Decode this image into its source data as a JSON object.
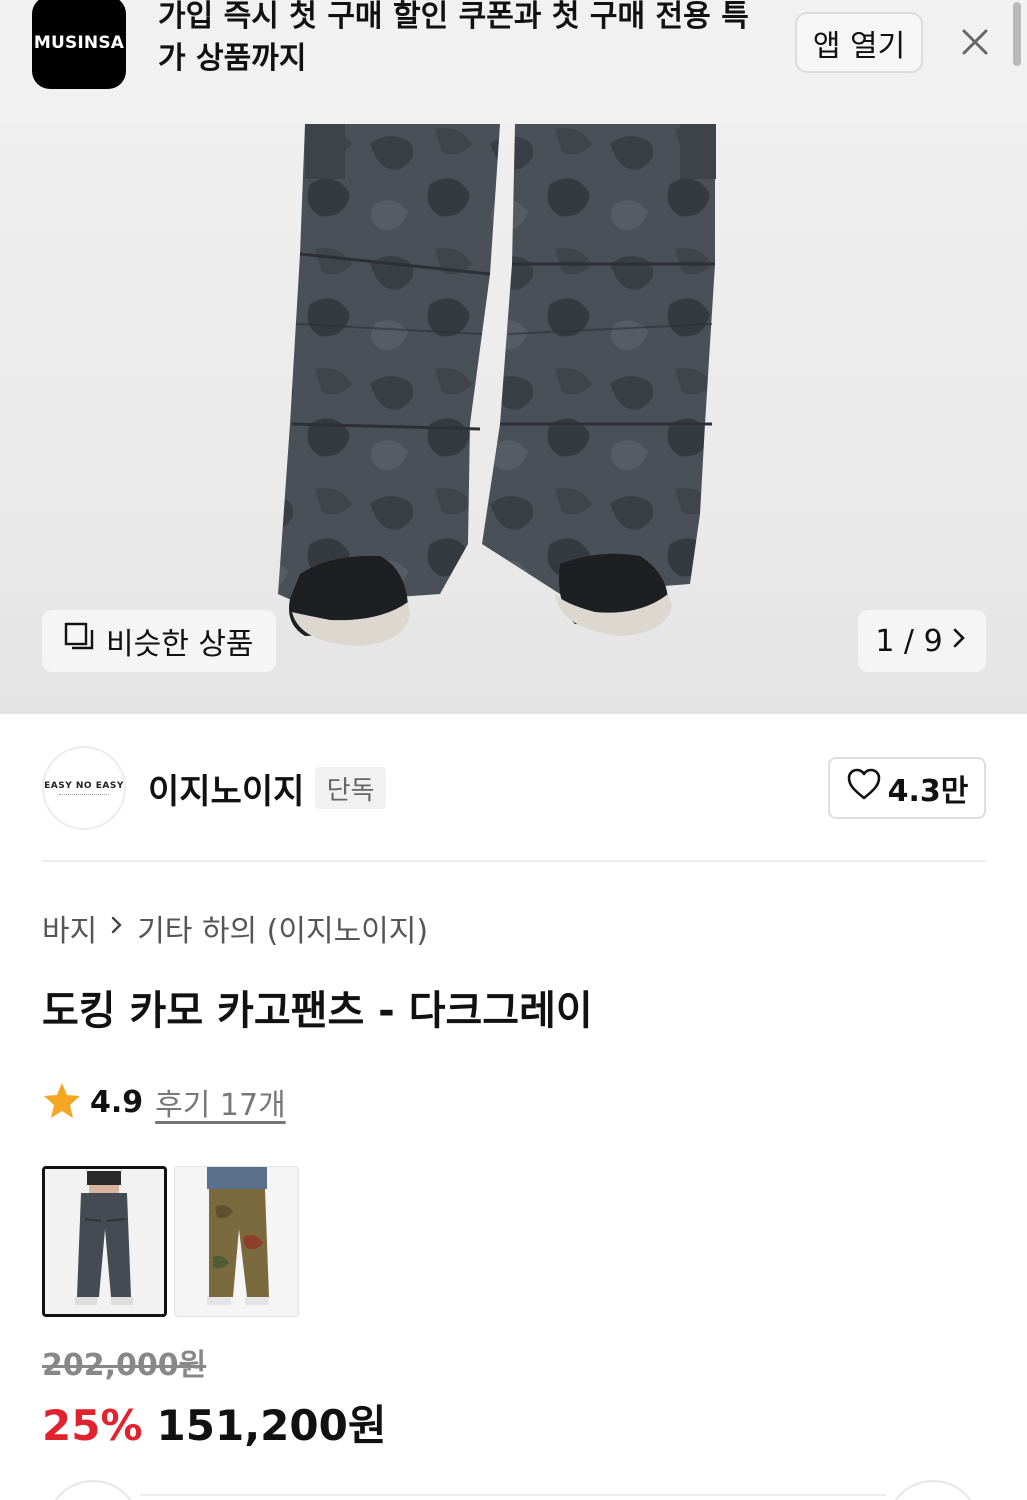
{
  "app_banner": {
    "logo_text": "MUSINSA",
    "message": "가입 즉시 첫 구매 할인 쿠폰과 첫 구매 전용 특가 상품까지",
    "open_app_label": "앱 열기",
    "close_icon": "close-icon"
  },
  "hero": {
    "similar_label": "비슷한 상품",
    "similar_icon": "copy-icon",
    "image_counter": "1 / 9",
    "next_icon": "chevron-right-icon"
  },
  "brand": {
    "logo_text": "EASY NO EASY",
    "name": "이지노이지",
    "badge": "단독",
    "like_count": "4.3만",
    "like_icon": "heart-icon"
  },
  "breadcrumb": {
    "items": [
      "바지",
      "기타 하의 (이지노이지)"
    ],
    "separator_icon": "chevron-right-icon"
  },
  "product": {
    "title": "도킹 카모 카고팬츠 - 다크그레이",
    "rating": "4.9",
    "review_label": "후기 17개",
    "star_icon": "star-icon",
    "star_color": "#f5a623",
    "color_options": [
      "dark-gray-camo",
      "brown-camo"
    ]
  },
  "price": {
    "original": "202,000원",
    "discount_rate": "25%",
    "sale": "151,200원",
    "discount_color": "#e0232f"
  }
}
